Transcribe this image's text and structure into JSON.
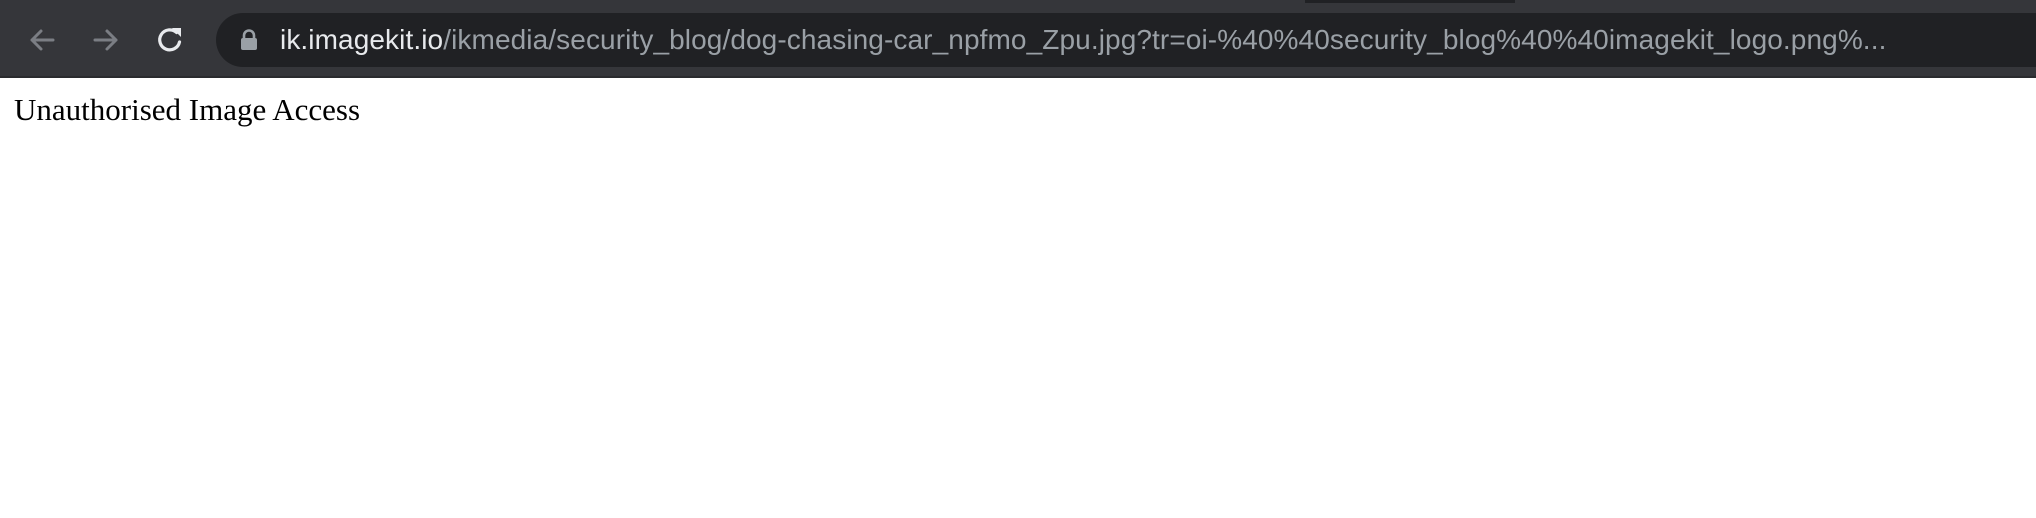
{
  "browser": {
    "toolbar_color": "#35363a",
    "omnibox_color": "#202124",
    "nav": {
      "back_icon": "arrow-left-icon",
      "forward_icon": "arrow-right-icon",
      "reload_icon": "reload-icon"
    },
    "address_bar": {
      "secure_icon": "lock-icon",
      "host": "ik.imagekit.io",
      "path": "/ikmedia/security_blog/dog-chasing-car_npfmo_Zpu.jpg?tr=oi-%40%40security_blog%40%40imagekit_logo.png%..."
    }
  },
  "page": {
    "background": "#ffffff",
    "message": "Unauthorised Image Access"
  }
}
